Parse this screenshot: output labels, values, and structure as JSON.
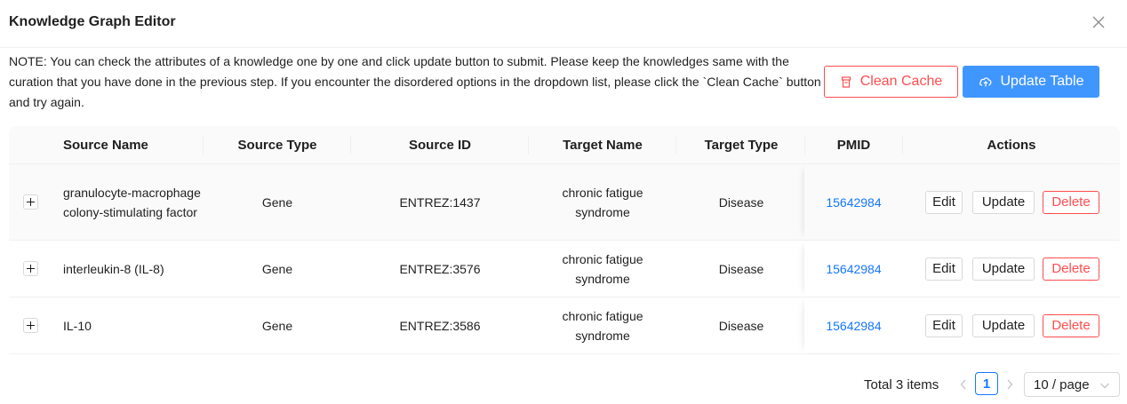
{
  "dialog": {
    "title": "Knowledge Graph Editor",
    "note": "NOTE: You can check the attributes of a knowledge one by one and click update button to submit. Please keep the knowledges same with the curation that you have done in the previous step. If you encounter the disordered options in the dropdown list, please click the `Clean Cache` button and try again."
  },
  "buttons": {
    "clean_cache": "Clean Cache",
    "update_table": "Update Table"
  },
  "table": {
    "columns": [
      "Source Name",
      "Source Type",
      "Source ID",
      "Target Name",
      "Target Type",
      "PMID",
      "Actions"
    ],
    "rows": [
      {
        "source_name": "granulocyte-macrophage colony-stimulating factor",
        "source_type": "Gene",
        "source_id": "ENTREZ:1437",
        "target_name": "chronic fatigue syndrome",
        "target_type": "Disease",
        "pmid": "15642984"
      },
      {
        "source_name": "interleukin-8 (IL-8)",
        "source_type": "Gene",
        "source_id": "ENTREZ:3576",
        "target_name": "chronic fatigue syndrome",
        "target_type": "Disease",
        "pmid": "15642984"
      },
      {
        "source_name": "IL-10",
        "source_type": "Gene",
        "source_id": "ENTREZ:3586",
        "target_name": "chronic fatigue syndrome",
        "target_type": "Disease",
        "pmid": "15642984"
      }
    ],
    "actions": {
      "edit": "Edit",
      "update": "Update",
      "delete": "Delete"
    }
  },
  "pagination": {
    "total": "Total 3 items",
    "current_page": "1",
    "page_size": "10 / page"
  },
  "colors": {
    "primary": "#1677ff",
    "primary_button": "#4096ff",
    "danger": "#ff4d4f"
  }
}
